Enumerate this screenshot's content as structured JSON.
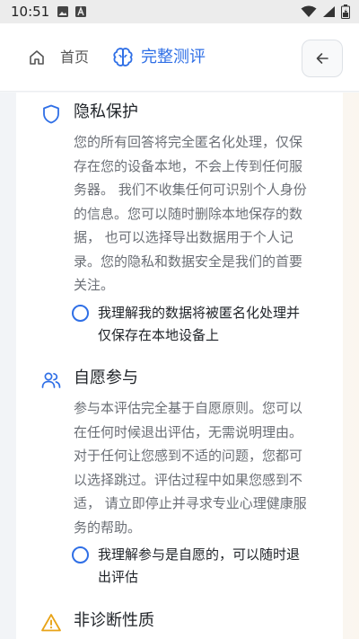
{
  "status_bar": {
    "time": "10:51",
    "left_icons": [
      "image-icon",
      "a-notification-icon"
    ],
    "right_icons": [
      "wifi-icon",
      "signal-icon",
      "battery-icon"
    ]
  },
  "header": {
    "home_label": "首页",
    "current_label": "完整测评",
    "accent_color": "#2f6fe6"
  },
  "sections": [
    {
      "icon": "shield-icon",
      "title": "隐私保护",
      "body_lines": [
        "您的所有回答将完全匿名化处理，仅保",
        "存在您的设备本地，不会上传到任何服",
        "务器。 我们不收集任何可识别个人身份",
        "的信息。您可以随时删除本地保存的数",
        "据， 也可以选择导出数据用于个人记",
        "录。您的隐私和数据安全是我们的首要",
        "关注。"
      ],
      "check_lines": [
        "我理解我的数据将被匿名化处理并",
        "仅保存在本地设备上"
      ]
    },
    {
      "icon": "users-icon",
      "title": "自愿参与",
      "body_lines": [
        "参与本评估完全基于自愿原则。您可以",
        "在任何时候退出评估，无需说明理由。",
        "对于任何让您感到不适的问题，您都可",
        "以选择跳过。评估过程中如果您感到不",
        "适， 请立即停止并寻求专业心理健康服",
        "务的帮助。"
      ],
      "check_lines": [
        "我理解参与是自愿的，可以随时退",
        "出评估"
      ]
    },
    {
      "icon": "warning-icon",
      "title": "非诊断性质"
    }
  ]
}
